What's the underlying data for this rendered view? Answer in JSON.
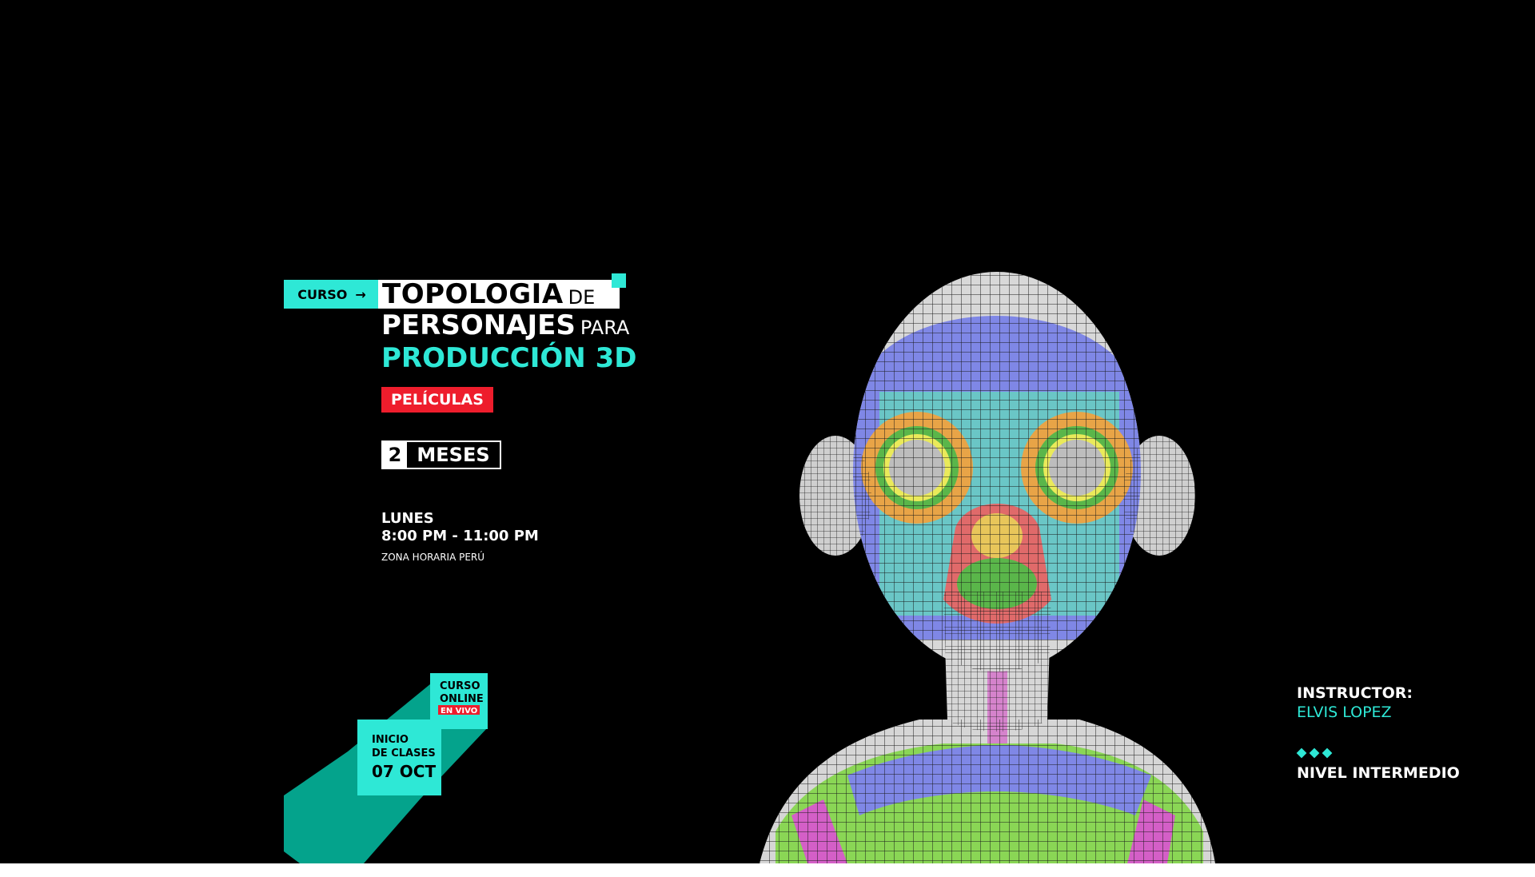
{
  "course": {
    "tag": "CURSO",
    "arrow": "→",
    "title_line1_main": "TOPOLOGIA",
    "title_line1_small": "DE",
    "title_line2_main": "PERSONAJES",
    "title_line2_small": "PARA",
    "title_line3": "PRODUCCIÓN 3D",
    "category": "PELÍCULAS",
    "duration_number": "2",
    "duration_unit": "MESES"
  },
  "schedule": {
    "day": "LUNES",
    "time": "8:00 PM - 11:00 PM",
    "timezone": "ZONA HORARIA PERÚ"
  },
  "badge": {
    "online_line1": "CURSO",
    "online_line2": "ONLINE",
    "live": "EN VIVO",
    "start_line1": "INICIO",
    "start_line2": "DE CLASES",
    "start_date": "07 OCT"
  },
  "instructor": {
    "label": "INSTRUCTOR:",
    "name": "ELVIS LOPEZ"
  },
  "level": {
    "text": "NIVEL INTERMEDIO"
  },
  "colors": {
    "accent": "#2ee8d6",
    "red": "#ee1d2c",
    "background": "#000000",
    "dark_teal": "#04a38c"
  }
}
